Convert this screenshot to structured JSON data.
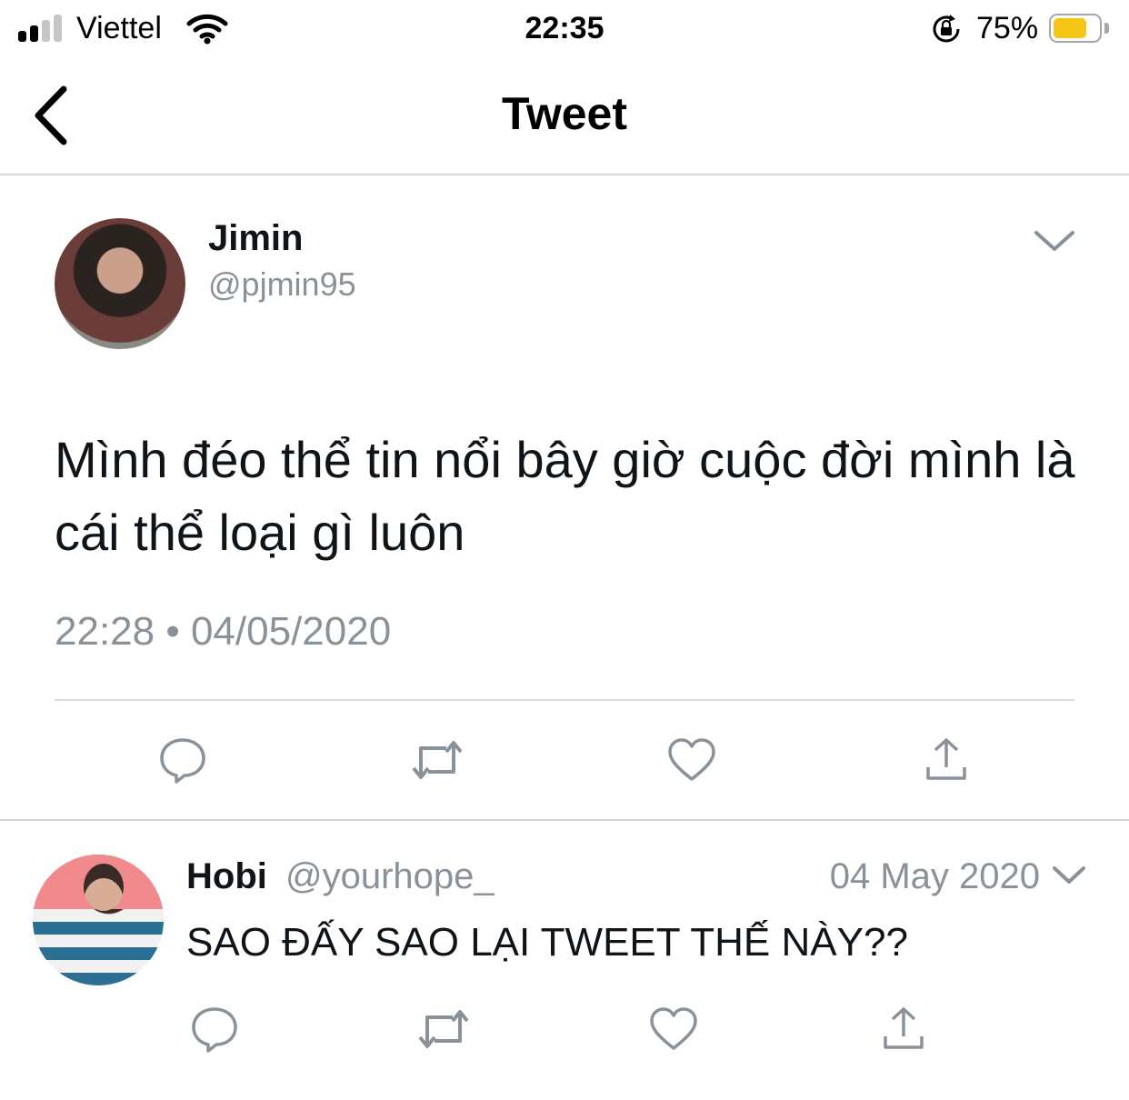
{
  "status_bar": {
    "carrier": "Viettel",
    "time": "22:35",
    "battery_percent": "75%",
    "battery_level": 0.75,
    "battery_color": "#f5c518",
    "signal_bars_active": 2,
    "icons": [
      "signal-icon",
      "wifi-icon",
      "orientation-lock-icon",
      "battery-icon"
    ]
  },
  "nav": {
    "title": "Tweet",
    "back_icon": "chevron-left-icon"
  },
  "tweet": {
    "author_name": "Jimin",
    "author_handle": "@pjmin95",
    "text": "Mình đéo thể tin nổi bây giờ cuộc đời mình là cái thể loại gì luôn",
    "timestamp": "22:28 • 04/05/2020",
    "actions": [
      "reply-icon",
      "retweet-icon",
      "like-icon",
      "share-icon"
    ]
  },
  "reply": {
    "author_name": "Hobi",
    "author_handle": "@yourhope_",
    "date": "04 May 2020",
    "text": "SAO ĐẤY SAO LẠI TWEET THẾ NÀY??",
    "actions": [
      "reply-icon",
      "retweet-icon",
      "like-icon",
      "share-icon"
    ]
  },
  "colors": {
    "text_primary": "#0f1419",
    "text_secondary": "#8a9299",
    "icon_gray": "#8a9299",
    "divider": "#dbdbdb"
  }
}
